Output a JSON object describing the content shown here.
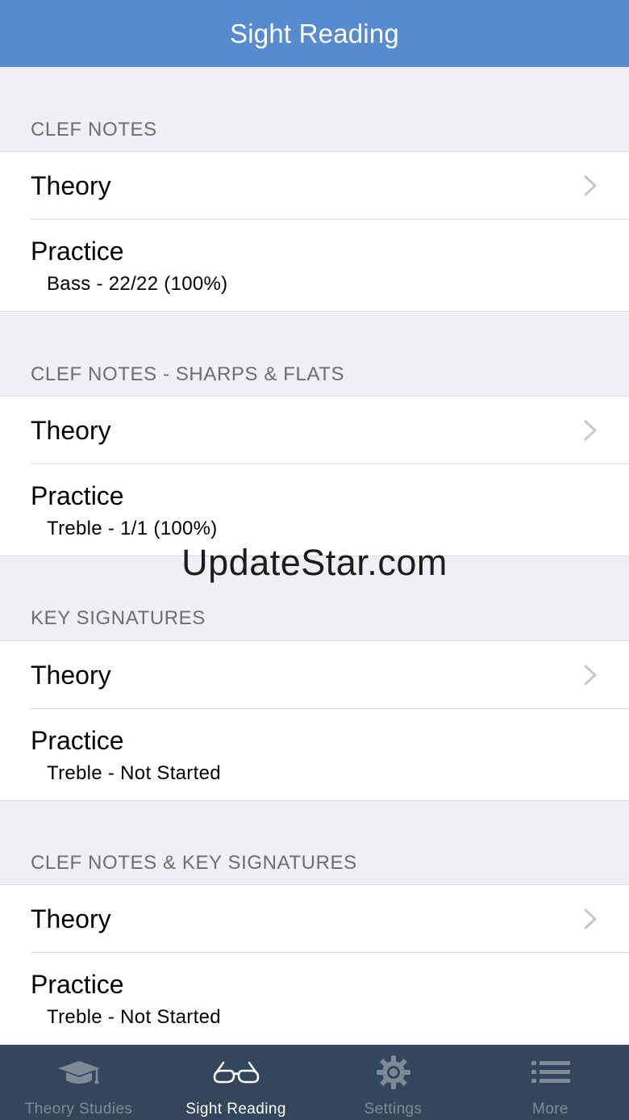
{
  "navbar": {
    "title": "Sight Reading"
  },
  "sections": [
    {
      "header": "CLEF NOTES",
      "theory_label": "Theory",
      "practice_label": "Practice",
      "practice_status": "Bass - 22/22 (100%)"
    },
    {
      "header": "CLEF NOTES - SHARPS & FLATS",
      "theory_label": "Theory",
      "practice_label": "Practice",
      "practice_status": "Treble - 1/1 (100%)"
    },
    {
      "header": "KEY SIGNATURES",
      "theory_label": "Theory",
      "practice_label": "Practice",
      "practice_status": "Treble - Not Started"
    },
    {
      "header": "CLEF NOTES & KEY SIGNATURES",
      "theory_label": "Theory",
      "practice_label": "Practice",
      "practice_status": "Treble - Not Started"
    }
  ],
  "watermark": "UpdateStar.com",
  "tabbar": {
    "tabs": [
      {
        "label": "Theory Studies",
        "icon": "graduation-cap-icon",
        "active": false
      },
      {
        "label": "Sight Reading",
        "icon": "glasses-icon",
        "active": true
      },
      {
        "label": "Settings",
        "icon": "gear-icon",
        "active": false
      },
      {
        "label": "More",
        "icon": "list-icon",
        "active": false
      }
    ]
  },
  "colors": {
    "navbar": "#568ccd",
    "tabbar": "#34465c",
    "tab_inactive": "#7f8a97",
    "tab_active": "#ffffff",
    "background": "#efeff4",
    "section_header": "#6d6d72"
  }
}
